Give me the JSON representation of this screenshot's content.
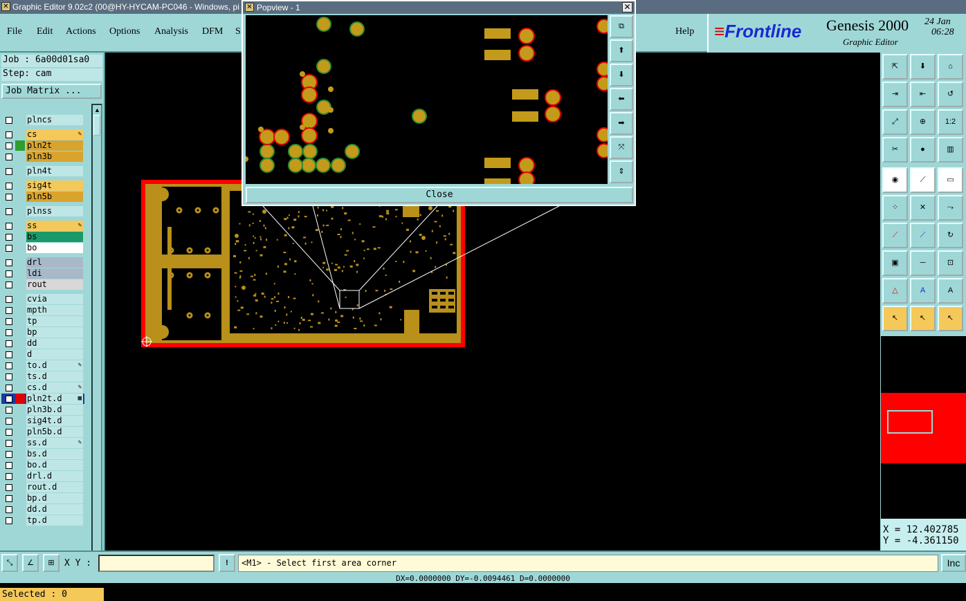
{
  "window": {
    "title": "Graphic Editor 9.02c2 (00@HY-HYCAM-PC046 - Windows, pi"
  },
  "menu": {
    "items": [
      "File",
      "Edit",
      "Actions",
      "Options",
      "Analysis",
      "DFM",
      "S"
    ],
    "help": "Help"
  },
  "logo": {
    "brand": "Frontline",
    "product": "Genesis 2000",
    "subtitle": "Graphic Editor",
    "date": "24 Jan",
    "time": "06:28"
  },
  "job": {
    "job_line": "Job : 6a00d01sa0",
    "step_line": "Step: cam",
    "matrix_button": "Job Matrix ..."
  },
  "layers": [
    {
      "name": "plncs",
      "color": "#bfe6e6",
      "swatch": "",
      "mark": ""
    },
    {
      "name": "cs",
      "color": "#f5c85a",
      "swatch": "",
      "mark": "✎"
    },
    {
      "name": "pln2t",
      "color": "#d9a42e",
      "swatch": "#2e9e2e",
      "mark": ""
    },
    {
      "name": "pln3b",
      "color": "#d9a42e",
      "swatch": "",
      "mark": ""
    },
    {
      "name": "pln4t",
      "color": "#bfe6e6",
      "swatch": "",
      "mark": ""
    },
    {
      "name": "sig4t",
      "color": "#f5c85a",
      "swatch": "",
      "mark": ""
    },
    {
      "name": "pln5b",
      "color": "#d9a42e",
      "swatch": "",
      "mark": ""
    },
    {
      "name": "plnss",
      "color": "#bfe6e6",
      "swatch": "",
      "mark": ""
    },
    {
      "name": "ss",
      "color": "#f5c85a",
      "swatch": "",
      "mark": "✎"
    },
    {
      "name": "bs",
      "color": "#1a9a6a",
      "swatch": "",
      "mark": ""
    },
    {
      "name": "bo",
      "color": "#ffffff",
      "swatch": "",
      "mark": ""
    },
    {
      "name": "drl",
      "color": "#a8b8c8",
      "swatch": "",
      "mark": ""
    },
    {
      "name": "ldi",
      "color": "#a8b8c8",
      "swatch": "",
      "mark": ""
    },
    {
      "name": "rout",
      "color": "#d8d8d8",
      "swatch": "",
      "mark": ""
    },
    {
      "name": "cvia",
      "color": "#bfe6e6",
      "swatch": "",
      "mark": ""
    },
    {
      "name": "mpth",
      "color": "#bfe6e6",
      "swatch": "",
      "mark": ""
    },
    {
      "name": "tp",
      "color": "#bfe6e6",
      "swatch": "",
      "mark": ""
    },
    {
      "name": "bp",
      "color": "#bfe6e6",
      "swatch": "",
      "mark": ""
    },
    {
      "name": "dd",
      "color": "#bfe6e6",
      "swatch": "",
      "mark": ""
    },
    {
      "name": "d",
      "color": "#bfe6e6",
      "swatch": "",
      "mark": ""
    },
    {
      "name": "to.d",
      "color": "#bfe6e6",
      "swatch": "",
      "mark": "✎"
    },
    {
      "name": "ts.d",
      "color": "#bfe6e6",
      "swatch": "",
      "mark": ""
    },
    {
      "name": "cs.d",
      "color": "#bfe6e6",
      "swatch": "",
      "mark": "✎"
    },
    {
      "name": "pln2t.d",
      "color": "#bfe6e6",
      "swatch": "#e00000",
      "mark": "▦"
    },
    {
      "name": "pln3b.d",
      "color": "#bfe6e6",
      "swatch": "",
      "mark": ""
    },
    {
      "name": "sig4t.d",
      "color": "#bfe6e6",
      "swatch": "",
      "mark": ""
    },
    {
      "name": "pln5b.d",
      "color": "#bfe6e6",
      "swatch": "",
      "mark": ""
    },
    {
      "name": "ss.d",
      "color": "#bfe6e6",
      "swatch": "",
      "mark": "✎"
    },
    {
      "name": "bs.d",
      "color": "#bfe6e6",
      "swatch": "",
      "mark": ""
    },
    {
      "name": "bo.d",
      "color": "#bfe6e6",
      "swatch": "",
      "mark": ""
    },
    {
      "name": "drl.d",
      "color": "#bfe6e6",
      "swatch": "",
      "mark": ""
    },
    {
      "name": "rout.d",
      "color": "#bfe6e6",
      "swatch": "",
      "mark": ""
    },
    {
      "name": "bp.d",
      "color": "#bfe6e6",
      "swatch": "",
      "mark": ""
    },
    {
      "name": "dd.d",
      "color": "#bfe6e6",
      "swatch": "",
      "mark": ""
    },
    {
      "name": "tp.d",
      "color": "#bfe6e6",
      "swatch": "",
      "mark": ""
    }
  ],
  "status": {
    "selected": "Selected : 0",
    "xy_label": "X Y :",
    "prompt": "<M1> - Select first area corner",
    "inc": "Inc",
    "foot": "DX=0.0000000 DY=-0.0094461 D=0.0000000"
  },
  "coords": {
    "x": "X = 12.402785",
    "y": "Y = -4.361150"
  },
  "popview": {
    "title": "Popview - 1",
    "close_button": "Close"
  },
  "toolbar": {
    "ratio_label": "1:2"
  },
  "colors": {
    "panel": "#9fd7d7",
    "copper": "#b8901a",
    "board_red": "#ff0000",
    "pad_green": "#3a9a3a"
  }
}
